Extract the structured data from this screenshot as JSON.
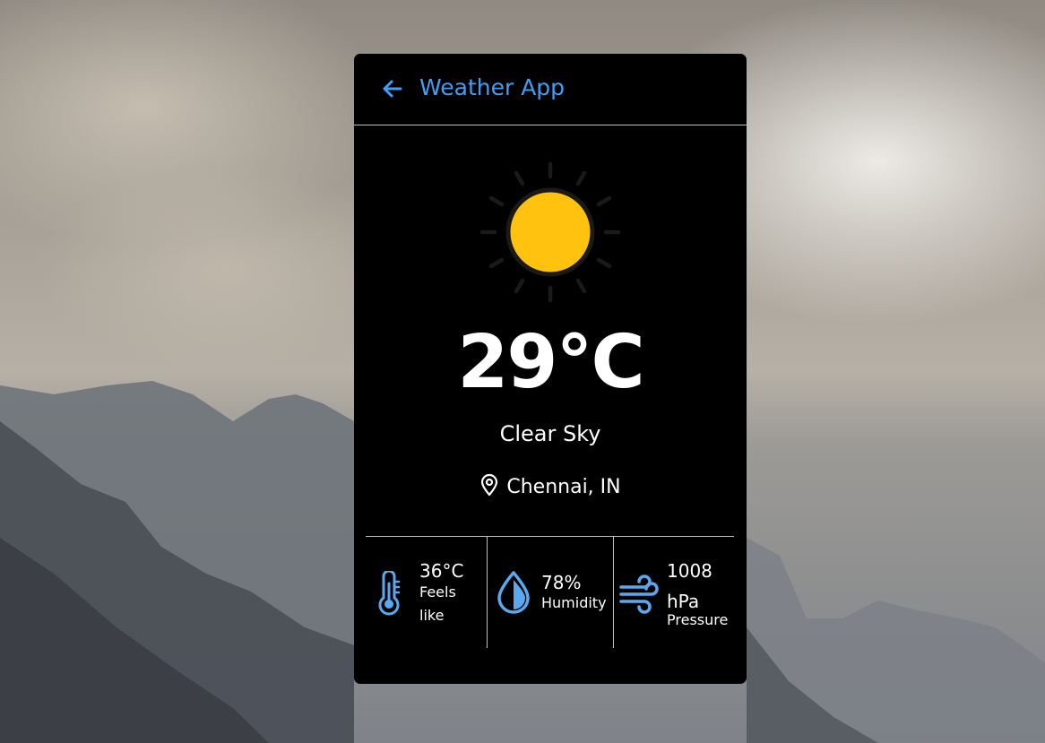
{
  "header": {
    "title": "Weather App",
    "back_icon": "arrow-left-icon"
  },
  "current": {
    "icon": "sun-icon",
    "temperature": "29°C",
    "description": "Clear Sky",
    "location": "Chennai, IN"
  },
  "details": [
    {
      "icon": "thermometer-icon",
      "value": "36°C",
      "label": "Feels like"
    },
    {
      "icon": "water-drop-icon",
      "value": "78%",
      "label": "Humidity"
    },
    {
      "icon": "wind-icon",
      "value": "1008 hPa",
      "label": "Pressure"
    }
  ],
  "colors": {
    "accent": "#3d9ff5",
    "card_bg": "#000000",
    "sun": "#ffc20e",
    "text": "#ffffff"
  }
}
